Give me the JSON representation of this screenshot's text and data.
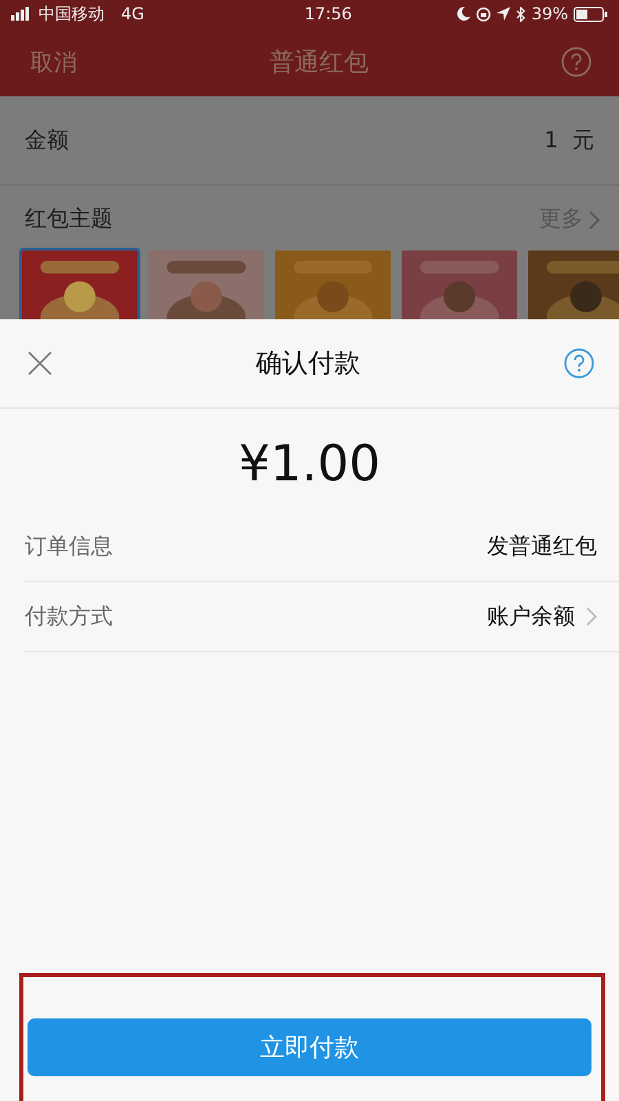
{
  "status_bar": {
    "carrier": "中国移动",
    "network": "4G",
    "time": "17:56",
    "battery": "39%"
  },
  "nav_bar": {
    "cancel": "取消",
    "title": "普通红包"
  },
  "amount_row": {
    "label": "金额",
    "value": "1",
    "unit": "元"
  },
  "theme_section": {
    "title": "红包主题",
    "more": "更多"
  },
  "themes": [
    {
      "kind": "picture",
      "selected": true
    },
    {
      "kind": "picture",
      "selected": false
    },
    {
      "kind": "picture",
      "selected": false
    },
    {
      "kind": "picture",
      "selected": false
    },
    {
      "kind": "picture",
      "selected": false
    }
  ],
  "payment_sheet": {
    "title": "确认付款",
    "amount": "¥1.00",
    "rows": [
      {
        "label": "订单信息",
        "value": "发普通红包",
        "has_arrow": false
      },
      {
        "label": "付款方式",
        "value": "账户余额",
        "has_arrow": true
      }
    ],
    "pay_button": "立即付款"
  }
}
